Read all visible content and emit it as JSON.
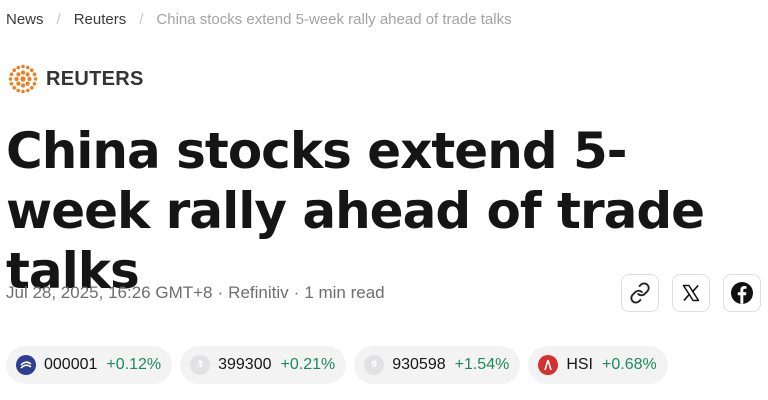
{
  "breadcrumb": {
    "items": [
      "News",
      "Reuters"
    ],
    "current": "China stocks extend 5-week rally ahead of trade talks",
    "separator": "/"
  },
  "logo": {
    "text": "REUTERS",
    "color": "#ef7d22",
    "icon": "reuters-dot-logo"
  },
  "article": {
    "title": "China stocks extend 5-week rally ahead of trade talks",
    "date": "Jul 28, 2025, 16:26 GMT+8",
    "source": "Refinitiv",
    "read_time": "1 min read",
    "meta_separator": "·"
  },
  "share": [
    {
      "icon": "link-icon",
      "label": "Copy link"
    },
    {
      "icon": "x-icon",
      "label": "Share on X"
    },
    {
      "icon": "facebook-icon",
      "label": "Share on Facebook"
    }
  ],
  "tickers": [
    {
      "symbol": "000001",
      "change": "+0.12%",
      "icon_color": "#2f3f8f",
      "badge": ""
    },
    {
      "symbol": "399300",
      "change": "+0.21%",
      "icon_color": "#e2e2e4",
      "badge": "3"
    },
    {
      "symbol": "930598",
      "change": "+1.54%",
      "icon_color": "#e2e2e4",
      "badge": "9"
    },
    {
      "symbol": "HSI",
      "change": "+0.68%",
      "icon_color": "#d3302f",
      "badge": ""
    }
  ],
  "colors": {
    "positive": "#1c8a5e",
    "muted": "#6e6e6e",
    "crumb_current": "#a3a3a3"
  }
}
